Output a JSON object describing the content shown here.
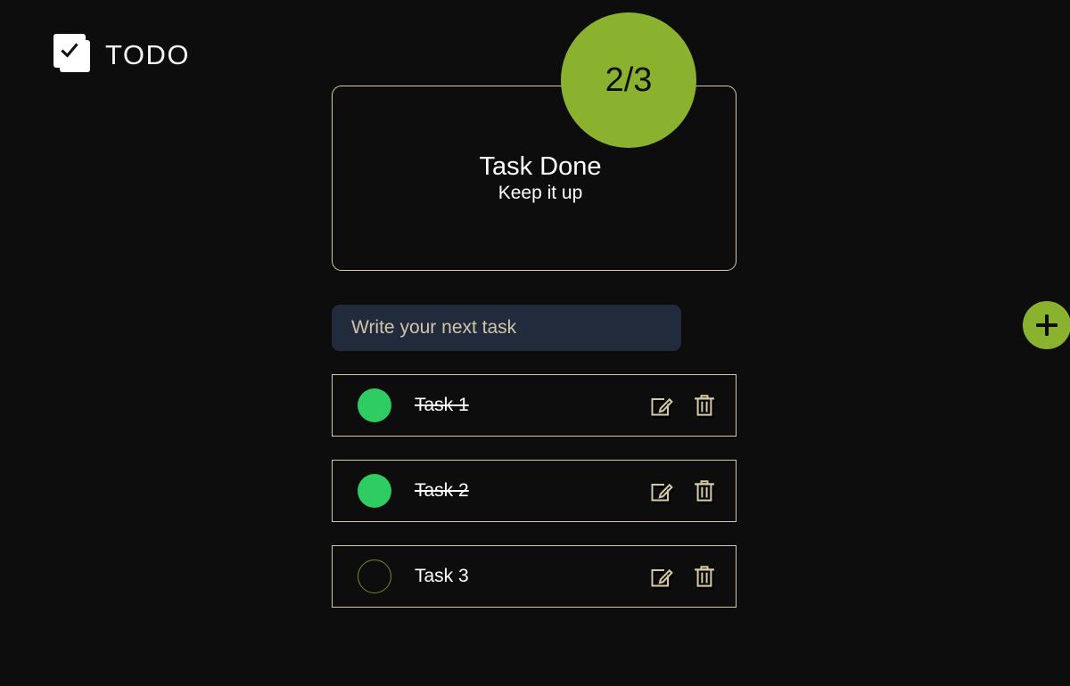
{
  "app": {
    "brand_name": "TODO",
    "logo_icon": "checkbox-stack-icon",
    "background_color": "#0d0d0d",
    "accent_color": "#8ab22f",
    "border_color": "#d7c8a9",
    "done_color": "#2ecc63",
    "input_background": "#222b3c"
  },
  "progress": {
    "heading": "Task Done",
    "subheading": "Keep it up",
    "ratio": "2/3",
    "completed": 2,
    "total": 3
  },
  "composer": {
    "placeholder": "Write your next task",
    "value": "",
    "add_button_label": "+",
    "add_button_icon": "plus-icon"
  },
  "tasks": [
    {
      "label": "Task 1",
      "done": true,
      "toggle_icon": "filled-circle-icon",
      "edit_icon": "pencil-square-icon",
      "delete_icon": "trash-icon"
    },
    {
      "label": "Task 2",
      "done": true,
      "toggle_icon": "filled-circle-icon",
      "edit_icon": "pencil-square-icon",
      "delete_icon": "trash-icon"
    },
    {
      "label": "Task 3",
      "done": false,
      "toggle_icon": "empty-circle-icon",
      "edit_icon": "pencil-square-icon",
      "delete_icon": "trash-icon"
    }
  ]
}
